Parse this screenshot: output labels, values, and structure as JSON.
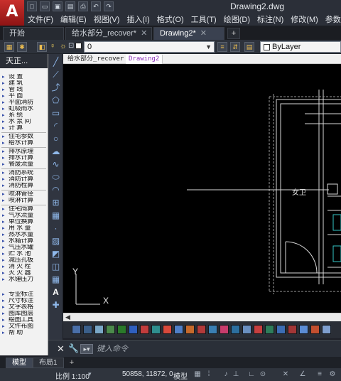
{
  "app": {
    "logo_letter": "A",
    "document_title": "Drawing2.dwg"
  },
  "menu": [
    "文件(F)",
    "编辑(E)",
    "视图(V)",
    "插入(I)",
    "格式(O)",
    "工具(T)",
    "绘图(D)",
    "标注(N)",
    "修改(M)",
    "参数"
  ],
  "tabs": [
    {
      "label": "开始",
      "closable": false,
      "active": false
    },
    {
      "label": "给水部分_recover*",
      "closable": true,
      "active": false
    },
    {
      "label": "Drawing2*",
      "closable": true,
      "active": true
    }
  ],
  "toolbar": {
    "layer_value": "0",
    "color_value": "ByLayer"
  },
  "left_panel": {
    "header": "天正...",
    "items": [
      "设  置",
      "建  筑",
      "管  线",
      "平  面",
      "平面消防",
      "虹吸雨水",
      "系  统",
      "水 泵 间",
      "计  算",
      "住宅参数",
      "给水计算",
      "排水原理",
      "排水计算",
      "餐废流量",
      "消防系统",
      "消防计算",
      "消防栓算",
      "喷淋管径",
      "喷淋计算",
      "住宅简算",
      "气水流量",
      "单位换算",
      "用 水 量",
      "热水水量",
      "水箱计算",
      "气压水罐",
      "贮 水 池",
      "减压孔板",
      "消 火 栓",
      "灭 火 器",
      "水锤压力",
      "专业标注",
      "尺寸标注",
      "文字表格",
      "图库图层",
      "绘图工具",
      "文件布图",
      "帮  助"
    ]
  },
  "canvas": {
    "tabs": [
      "给水部分_recover",
      "Drawing2"
    ],
    "room_label": "女卫",
    "ucs_x": "X",
    "ucs_y": "Y"
  },
  "command": {
    "placeholder": "键入命令"
  },
  "layout_tabs": [
    "模型",
    "布局1"
  ],
  "status": {
    "scale": "比例 1:100",
    "coords": "50858, 11872, 0",
    "mode": "模型"
  },
  "colors": {
    "bg": "#1e2027",
    "canvas_bg": "#000000",
    "drawing_lines": "#d9d9d9",
    "accent_cyan": "#34c6c6",
    "active_tab_text": "#8a2bb8"
  }
}
